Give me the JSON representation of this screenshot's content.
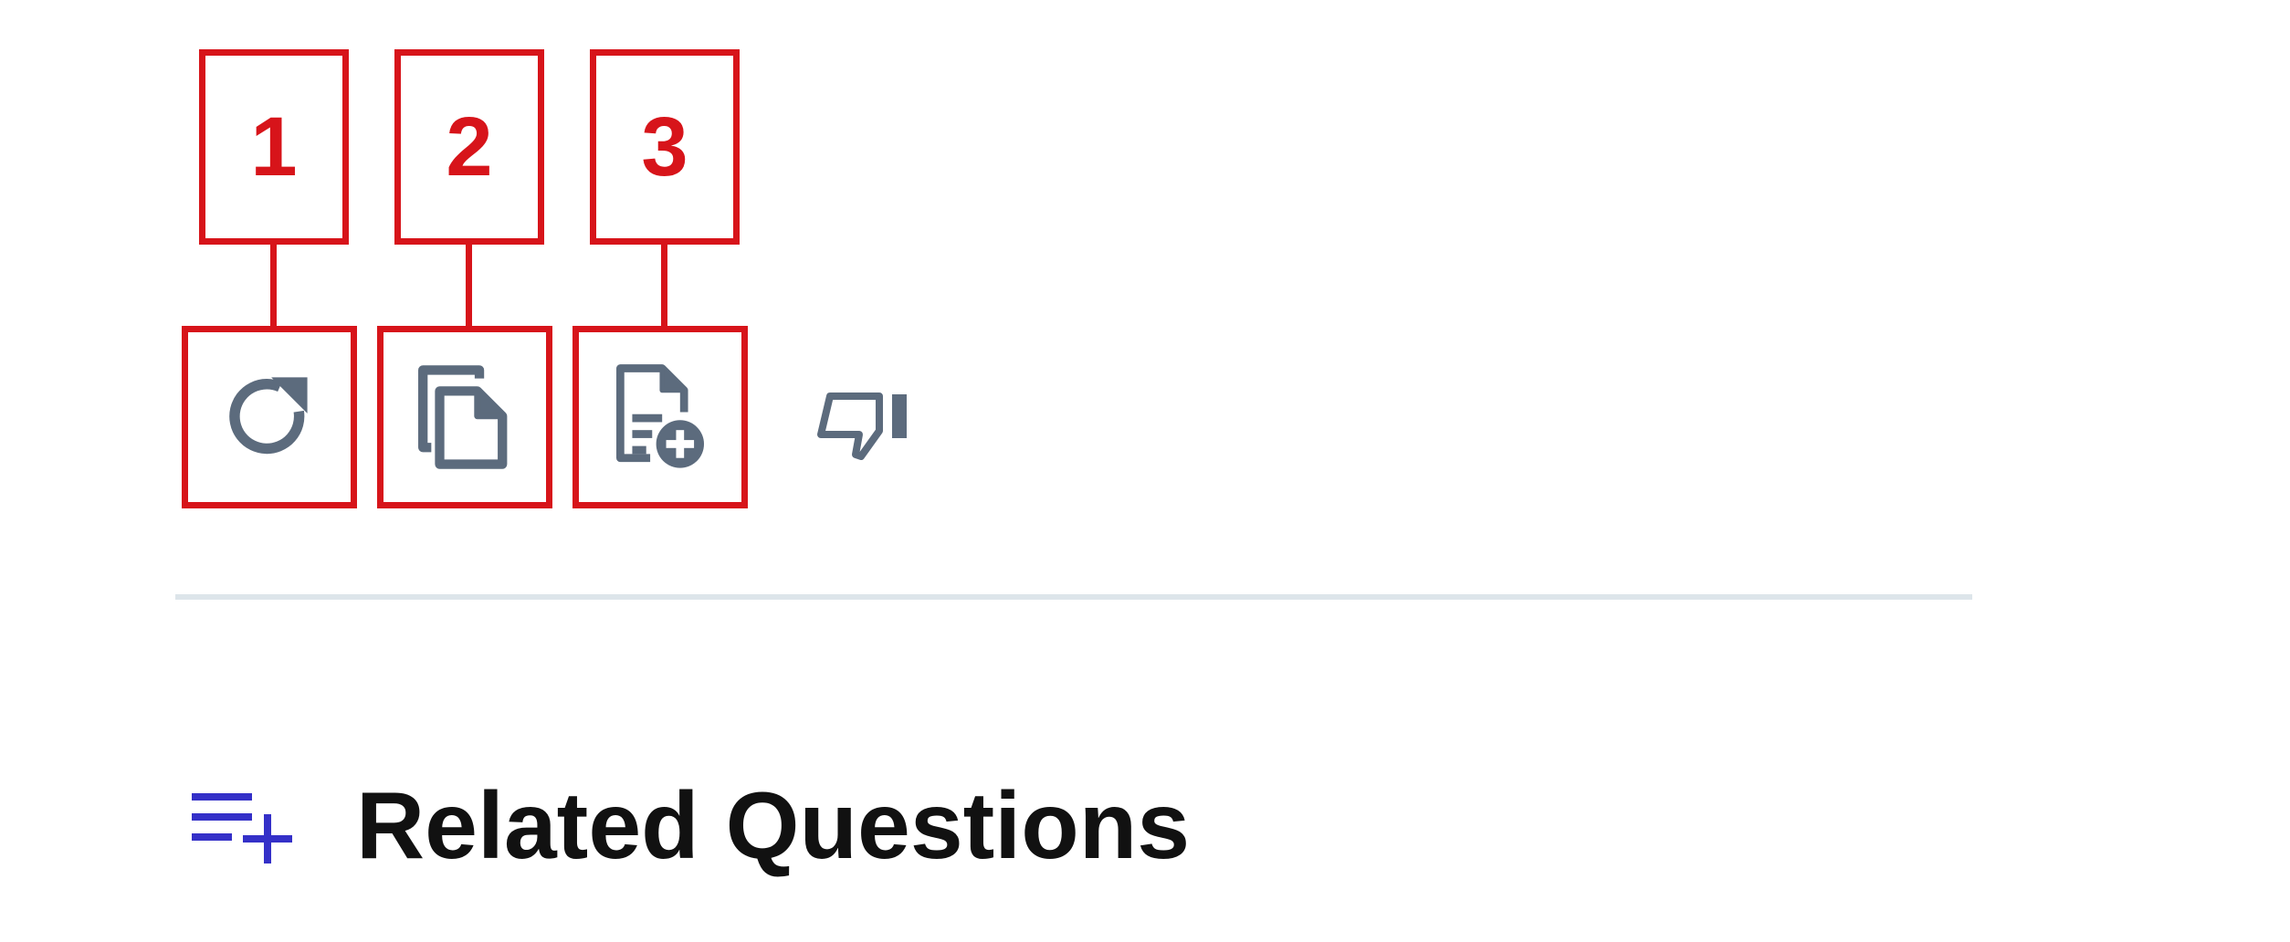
{
  "callouts": [
    "1",
    "2",
    "3"
  ],
  "actions": [
    {
      "icon": "refresh-icon",
      "label": "Regenerate"
    },
    {
      "icon": "copy-icon",
      "label": "Copy"
    },
    {
      "icon": "add-to-page-icon",
      "label": "Add to page"
    },
    {
      "icon": "thumbs-down-icon",
      "label": "Dislike"
    }
  ],
  "related": {
    "icon": "list-add-icon",
    "title": "Related Questions"
  },
  "colors": {
    "callout_red": "#d7141a",
    "icon_gray": "#5c6b7d",
    "accent_blue": "#3430c8",
    "divider": "#dde5ea",
    "title_text": "#111111"
  }
}
